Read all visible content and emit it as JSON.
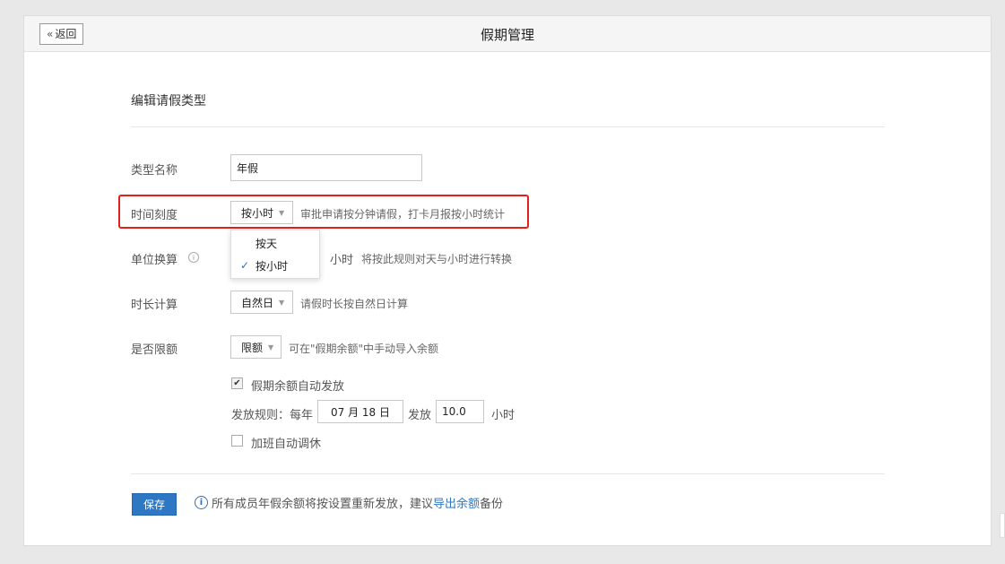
{
  "header": {
    "back_label": "返回",
    "back_icon": "double-chevron-left-icon",
    "title": "假期管理"
  },
  "form": {
    "section_title": "编辑请假类型",
    "type_name": {
      "label": "类型名称",
      "value": "年假"
    },
    "time_scale": {
      "label": "时间刻度",
      "selected": "按小时",
      "hint": "审批申请按分钟请假，打卡月报按小时统计"
    },
    "time_scale_dropdown": {
      "options": [
        "按天",
        "按小时"
      ],
      "checked": "按小时"
    },
    "unit_conversion": {
      "label": "单位换算",
      "unit": "小时",
      "hint": "将按此规则对天与小时进行转换"
    },
    "duration_calc": {
      "label": "时长计算",
      "selected": "自然日",
      "hint": "请假时长按自然日计算"
    },
    "limit": {
      "label": "是否限额",
      "selected": "限额",
      "hint": "可在\"假期余额\"中手动导入余额"
    },
    "auto_issue": {
      "label": "假期余额自动发放",
      "checked": true
    },
    "issue_rule": {
      "prefix": "发放规则：每年",
      "date": "07 月 18 日",
      "middle": "发放",
      "amount": "10.0",
      "unit": "小时"
    },
    "overtime": {
      "label": "加班自动调休",
      "checked": false
    }
  },
  "footer": {
    "save_label": "保存",
    "notice_before": "所有成员年假余额将按设置重新发放，建议",
    "notice_link": "导出余额",
    "notice_after": "备份"
  },
  "colors": {
    "primary": "#2d77c4",
    "highlight_border": "#e0211c"
  }
}
